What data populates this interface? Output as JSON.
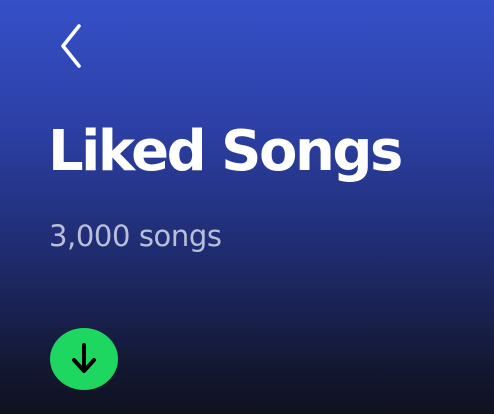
{
  "header": {
    "back_icon": "chevron-left-icon"
  },
  "playlist": {
    "title": "Liked Songs",
    "song_count_label": "3,000 songs"
  },
  "actions": {
    "download_icon": "download-arrow-icon",
    "download_color": "#1ed760"
  },
  "theme": {
    "gradient_top": "#3550c8",
    "gradient_bottom": "#101220",
    "text_primary": "#ffffff",
    "text_secondary": "#b9bfd9"
  }
}
